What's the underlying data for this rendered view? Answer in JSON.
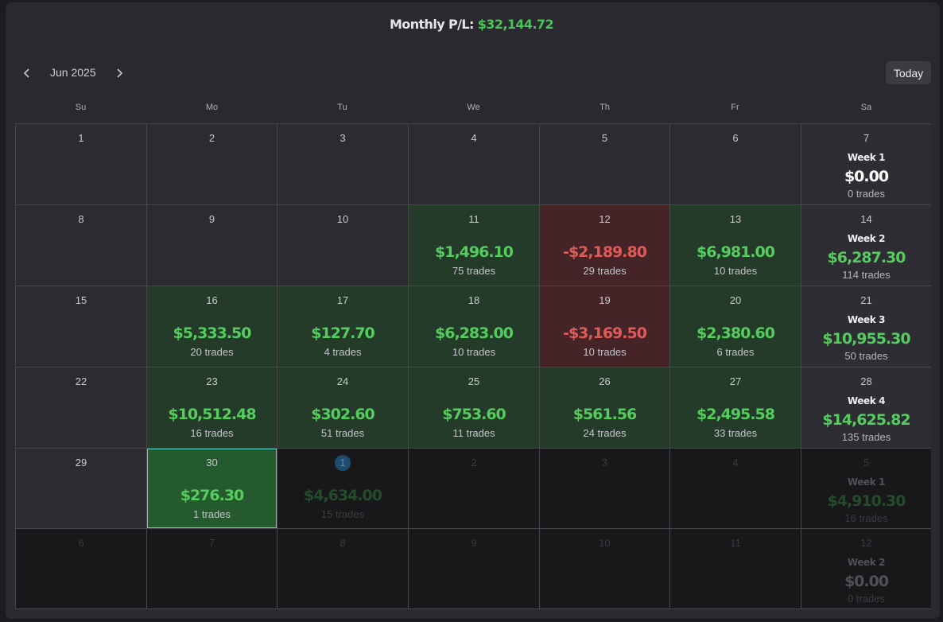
{
  "header": {
    "label": "Monthly P/L:",
    "value": "$32,144.72"
  },
  "nav": {
    "month": "Jun 2025",
    "today_label": "Today"
  },
  "weekdays": [
    "Su",
    "Mo",
    "Tu",
    "We",
    "Th",
    "Fr",
    "Sa"
  ],
  "weeks": [
    {
      "days": [
        {
          "day": "1"
        },
        {
          "day": "2"
        },
        {
          "day": "3"
        },
        {
          "day": "4"
        },
        {
          "day": "5"
        },
        {
          "day": "6"
        }
      ],
      "summary": {
        "day": "7",
        "label": "Week 1",
        "amount": "$0.00",
        "trades": "0 trades",
        "tone": "zero"
      }
    },
    {
      "days": [
        {
          "day": "8"
        },
        {
          "day": "9"
        },
        {
          "day": "10"
        },
        {
          "day": "11",
          "amount": "$1,496.10",
          "trades": "75 trades",
          "tone": "pos"
        },
        {
          "day": "12",
          "amount": "-$2,189.80",
          "trades": "29 trades",
          "tone": "neg"
        },
        {
          "day": "13",
          "amount": "$6,981.00",
          "trades": "10 trades",
          "tone": "pos"
        }
      ],
      "summary": {
        "day": "14",
        "label": "Week 2",
        "amount": "$6,287.30",
        "trades": "114 trades",
        "tone": "pos"
      }
    },
    {
      "days": [
        {
          "day": "15"
        },
        {
          "day": "16",
          "amount": "$5,333.50",
          "trades": "20 trades",
          "tone": "pos"
        },
        {
          "day": "17",
          "amount": "$127.70",
          "trades": "4 trades",
          "tone": "pos"
        },
        {
          "day": "18",
          "amount": "$6,283.00",
          "trades": "10 trades",
          "tone": "pos"
        },
        {
          "day": "19",
          "amount": "-$3,169.50",
          "trades": "10 trades",
          "tone": "neg"
        },
        {
          "day": "20",
          "amount": "$2,380.60",
          "trades": "6 trades",
          "tone": "pos"
        }
      ],
      "summary": {
        "day": "21",
        "label": "Week 3",
        "amount": "$10,955.30",
        "trades": "50 trades",
        "tone": "pos"
      }
    },
    {
      "days": [
        {
          "day": "22"
        },
        {
          "day": "23",
          "amount": "$10,512.48",
          "trades": "16 trades",
          "tone": "pos"
        },
        {
          "day": "24",
          "amount": "$302.60",
          "trades": "51 trades",
          "tone": "pos"
        },
        {
          "day": "25",
          "amount": "$753.60",
          "trades": "11 trades",
          "tone": "pos"
        },
        {
          "day": "26",
          "amount": "$561.56",
          "trades": "24 trades",
          "tone": "pos"
        },
        {
          "day": "27",
          "amount": "$2,495.58",
          "trades": "33 trades",
          "tone": "pos"
        }
      ],
      "summary": {
        "day": "28",
        "label": "Week 4",
        "amount": "$14,625.82",
        "trades": "135 trades",
        "tone": "pos"
      }
    },
    {
      "days": [
        {
          "day": "29"
        },
        {
          "day": "30",
          "amount": "$276.30",
          "trades": "1 trades",
          "tone": "pos",
          "selected": true
        },
        {
          "day": "1",
          "amount": "$4,634.00",
          "trades": "15 trades",
          "tone": "pos",
          "other": true,
          "today": true
        },
        {
          "day": "2",
          "other": true
        },
        {
          "day": "3",
          "other": true
        },
        {
          "day": "4",
          "other": true
        }
      ],
      "summary": {
        "day": "5",
        "label": "Week 1",
        "amount": "$4,910.30",
        "trades": "16 trades",
        "tone": "pos",
        "other": true
      }
    },
    {
      "days": [
        {
          "day": "6",
          "other": true
        },
        {
          "day": "7",
          "other": true
        },
        {
          "day": "8",
          "other": true
        },
        {
          "day": "9",
          "other": true
        },
        {
          "day": "10",
          "other": true
        },
        {
          "day": "11",
          "other": true
        }
      ],
      "summary": {
        "day": "12",
        "label": "Week 2",
        "amount": "$0.00",
        "trades": "0 trades",
        "tone": "zero",
        "other": true
      }
    }
  ],
  "colors": {
    "positive": "#55cc5e",
    "negative": "#e05a58",
    "selected_border": "#5cd0c8"
  }
}
